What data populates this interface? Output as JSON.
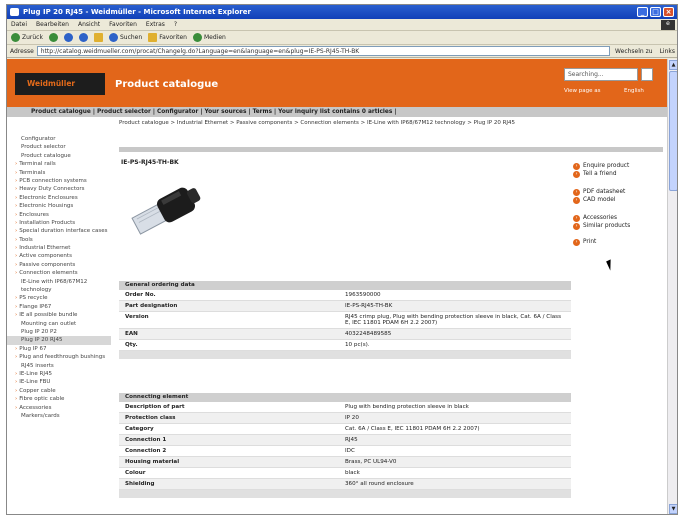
{
  "window": {
    "title": "Plug IP 20 RJ45 - Weidmüller - Microsoft Internet Explorer"
  },
  "menu": [
    "Datei",
    "Bearbeiten",
    "Ansicht",
    "Favoriten",
    "Extras",
    "?"
  ],
  "toolbar": {
    "back": "Zurück",
    "search": "Suchen",
    "favorites": "Favoriten",
    "media": "Medien"
  },
  "address": {
    "label": "Adresse",
    "url": "http://catalog.weidmueller.com/procat/Changelg.do?Language=en&language=en&plug=IE-PS-RJ45-TH-BK",
    "go": "Wechseln zu",
    "links": "Links"
  },
  "header": {
    "logo": "Weidmüller",
    "title": "Product catalogue",
    "search_placeholder": "Searching...",
    "view_page": "View page as",
    "language": "English"
  },
  "topnav": "Product catalogue | Product selector | Configurator | Your sources | Terms | Your inquiry list contains 0 articles |",
  "breadcrumb": "Product catalogue  >  Industrial Ethernet  >  Passive components  >  Connection elements  >  IE-Line with IP68/67M12 technology  >  Plug IP 20 RJ45",
  "sidebar": [
    {
      "label": "Configurator",
      "active": false,
      "o": false
    },
    {
      "label": "Product selector",
      "active": false,
      "o": false
    },
    {
      "label": "Product catalogue",
      "active": false,
      "o": false
    },
    {
      "label": "Terminal rails",
      "active": false,
      "o": true
    },
    {
      "label": "Terminals",
      "active": false,
      "o": true
    },
    {
      "label": "PCB connection systems",
      "active": false,
      "o": true
    },
    {
      "label": "Heavy Duty Connectors",
      "active": false,
      "o": true
    },
    {
      "label": "Electronic Enclosures",
      "active": false,
      "o": true
    },
    {
      "label": "Electronic Housings",
      "active": false,
      "o": true
    },
    {
      "label": "Enclosures",
      "active": false,
      "o": true
    },
    {
      "label": "Installation Products",
      "active": false,
      "o": true
    },
    {
      "label": "Special duration interface cases",
      "active": false,
      "o": true
    },
    {
      "label": "Tools",
      "active": false,
      "o": true
    },
    {
      "label": "Industrial Ethernet",
      "active": false,
      "o": true
    },
    {
      "label": "Active components",
      "active": false,
      "o": true
    },
    {
      "label": "Passive components",
      "active": false,
      "o": true
    },
    {
      "label": "Connection elements",
      "active": false,
      "o": true
    },
    {
      "label": "IE-Line with IP68/67M12",
      "active": false,
      "o": false
    },
    {
      "label": "technology",
      "active": false,
      "o": false
    },
    {
      "label": "PS recycle",
      "active": false,
      "o": true
    },
    {
      "label": "Flange IP67",
      "active": false,
      "o": true
    },
    {
      "label": "IE all possible bundle",
      "active": false,
      "o": true
    },
    {
      "label": "Mounting can outlet",
      "active": false,
      "o": false
    },
    {
      "label": "Plug IP 20 P2",
      "active": false,
      "o": false
    },
    {
      "label": "Plug IP 20 RJ45",
      "active": true,
      "o": false
    },
    {
      "label": "Plug IP 67",
      "active": false,
      "o": true
    },
    {
      "label": "Plug and feedthrough bushings",
      "active": false,
      "o": true
    },
    {
      "label": "RJ45 inserts",
      "active": false,
      "o": false
    },
    {
      "label": "IE-Line RJ45",
      "active": false,
      "o": true
    },
    {
      "label": "IE-Line FBU",
      "active": false,
      "o": true
    },
    {
      "label": "Copper cable",
      "active": false,
      "o": true
    },
    {
      "label": "Fibre optic cable",
      "active": false,
      "o": true
    },
    {
      "label": "Accessories",
      "active": false,
      "o": true
    },
    {
      "label": "Markers/cards",
      "active": false,
      "o": false
    }
  ],
  "product": {
    "title": "IE-PS-RJ45-TH-BK"
  },
  "actions": [
    {
      "label": "Enquire product",
      "icon": "arrow-icon"
    },
    {
      "label": "Tell a friend",
      "icon": "mail-icon"
    },
    {
      "label": "PDF datasheet",
      "icon": "pdf-icon"
    },
    {
      "label": "CAD model",
      "icon": "cad-icon"
    },
    {
      "label": "Accessories",
      "icon": "accessories-icon"
    },
    {
      "label": "Similar products",
      "icon": "similar-icon"
    },
    {
      "label": "Print",
      "icon": "print-icon"
    }
  ],
  "table1": {
    "title": "General ordering data",
    "rows": [
      {
        "label": "Order No.",
        "value": "1963590000"
      },
      {
        "label": "Part designation",
        "value": "IE-PS-RJ45-TH-BK"
      },
      {
        "label": "Version",
        "value": "RJ45 crimp plug, Plug with bending protection sleeve in black, Cat. 6A / Class E, IEC 11801 PDAM 6H 2.2 2007)"
      },
      {
        "label": "EAN",
        "value": "4032248489585"
      },
      {
        "label": "Qty.",
        "value": "10 pc(s)."
      }
    ]
  },
  "table2": {
    "title": "Connecting element",
    "rows": [
      {
        "label": "Description of part",
        "value": "Plug with bending protection sleeve in black"
      },
      {
        "label": "Protection class",
        "value": "IP 20"
      },
      {
        "label": "Category",
        "value": "Cat. 6A / Class E, IEC 11801 PDAM 6H 2.2 2007)"
      },
      {
        "label": "Connection 1",
        "value": "RJ45"
      },
      {
        "label": "Connection 2",
        "value": "IDC"
      },
      {
        "label": "Housing material",
        "value": "Brass, PC UL94-V0"
      },
      {
        "label": "Colour",
        "value": "black"
      },
      {
        "label": "Shielding",
        "value": "360° all round enclosure"
      }
    ]
  }
}
